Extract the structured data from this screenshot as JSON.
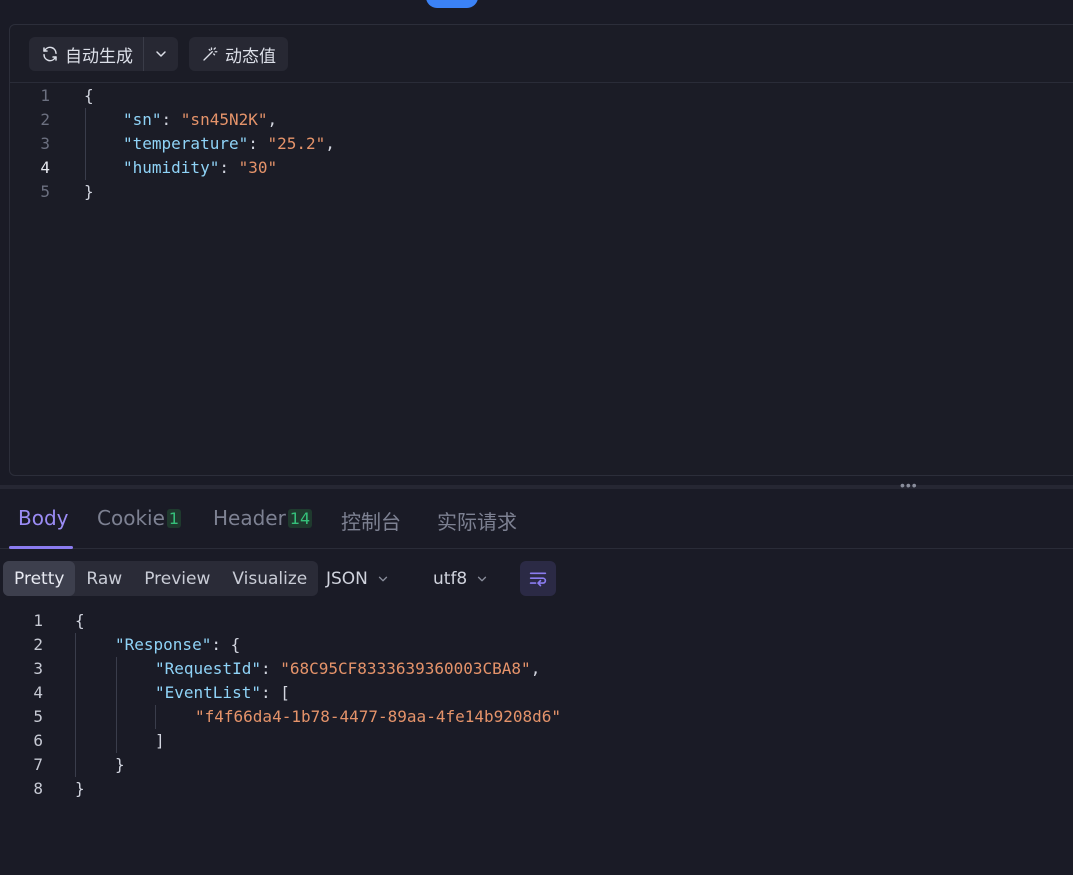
{
  "request_toolbar": {
    "auto_generate_label": "自动生成",
    "dynamic_value_label": "动态值"
  },
  "request_body": {
    "lines": [
      {
        "n": "1",
        "parts": [
          {
            "t": "{",
            "c": "p"
          }
        ]
      },
      {
        "n": "2",
        "parts": [
          {
            "t": "\"sn\"",
            "c": "k"
          },
          {
            "t": ": ",
            "c": "p"
          },
          {
            "t": "\"sn45N2K\"",
            "c": "s"
          },
          {
            "t": ",",
            "c": "p"
          }
        ]
      },
      {
        "n": "3",
        "parts": [
          {
            "t": "\"temperature\"",
            "c": "k"
          },
          {
            "t": ": ",
            "c": "p"
          },
          {
            "t": "\"25.2\"",
            "c": "s"
          },
          {
            "t": ",",
            "c": "p"
          }
        ]
      },
      {
        "n": "4",
        "parts": [
          {
            "t": "\"humidity\"",
            "c": "k"
          },
          {
            "t": ": ",
            "c": "p"
          },
          {
            "t": "\"30\"",
            "c": "s"
          }
        ]
      },
      {
        "n": "5",
        "parts": [
          {
            "t": "}",
            "c": "p"
          }
        ]
      }
    ]
  },
  "response_tabs": {
    "body": "Body",
    "cookie": "Cookie",
    "cookie_count": "1",
    "header": "Header",
    "header_count": "14",
    "console": "控制台",
    "actual_request": "实际请求"
  },
  "response_toolbar": {
    "pretty": "Pretty",
    "raw": "Raw",
    "preview": "Preview",
    "visualize": "Visualize",
    "format": "JSON",
    "encoding": "utf8"
  },
  "response_body": {
    "lines": [
      {
        "n": "1",
        "parts": [
          {
            "t": "{",
            "c": "p"
          }
        ]
      },
      {
        "n": "2",
        "parts": [
          {
            "t": "\"Response\"",
            "c": "k"
          },
          {
            "t": ": {",
            "c": "p"
          }
        ]
      },
      {
        "n": "3",
        "parts": [
          {
            "t": "\"RequestId\"",
            "c": "k"
          },
          {
            "t": ": ",
            "c": "p"
          },
          {
            "t": "\"68C95CF8333639360003CBA8\"",
            "c": "s"
          },
          {
            "t": ",",
            "c": "p"
          }
        ]
      },
      {
        "n": "4",
        "parts": [
          {
            "t": "\"EventList\"",
            "c": "k"
          },
          {
            "t": ": [",
            "c": "p"
          }
        ]
      },
      {
        "n": "5",
        "parts": [
          {
            "t": "\"f4f66da4-1b78-4477-89aa-4fe14b9208d6\"",
            "c": "s"
          }
        ]
      },
      {
        "n": "6",
        "parts": [
          {
            "t": "]",
            "c": "p"
          }
        ]
      },
      {
        "n": "7",
        "parts": [
          {
            "t": "}",
            "c": "p"
          }
        ]
      },
      {
        "n": "8",
        "parts": [
          {
            "t": "}",
            "c": "p"
          }
        ]
      }
    ]
  },
  "colors": {
    "accent": "#9b8cf5",
    "json_key": "#8fd3f7",
    "json_string": "#e5936a",
    "badge_green": "#35c07a"
  }
}
